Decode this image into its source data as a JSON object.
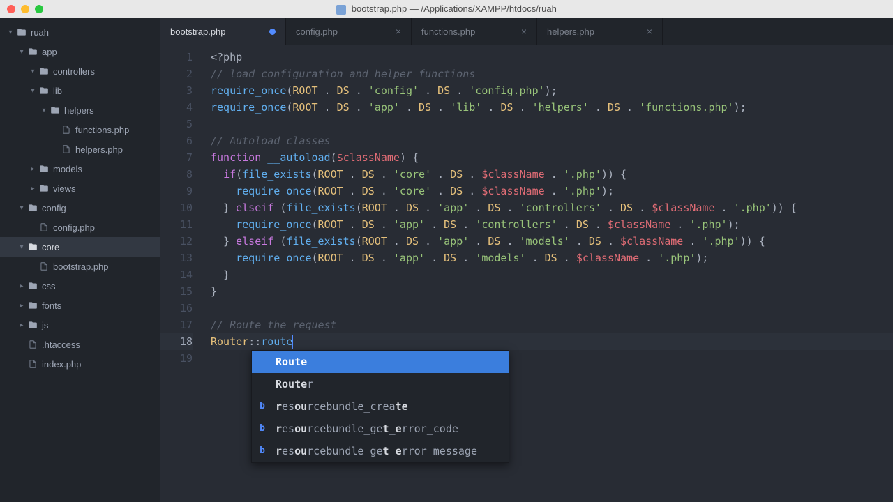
{
  "window": {
    "title": "bootstrap.php — /Applications/XAMPP/htdocs/ruah"
  },
  "sidebar": [
    {
      "depth": 0,
      "label": "ruah",
      "type": "folder",
      "open": true
    },
    {
      "depth": 1,
      "label": "app",
      "type": "folder",
      "open": true
    },
    {
      "depth": 2,
      "label": "controllers",
      "type": "folder",
      "open": true
    },
    {
      "depth": 2,
      "label": "lib",
      "type": "folder",
      "open": true
    },
    {
      "depth": 3,
      "label": "helpers",
      "type": "folder",
      "open": true
    },
    {
      "depth": 4,
      "label": "functions.php",
      "type": "file"
    },
    {
      "depth": 4,
      "label": "helpers.php",
      "type": "file"
    },
    {
      "depth": 2,
      "label": "models",
      "type": "folder",
      "open": false
    },
    {
      "depth": 2,
      "label": "views",
      "type": "folder",
      "open": false
    },
    {
      "depth": 1,
      "label": "config",
      "type": "folder",
      "open": true
    },
    {
      "depth": 2,
      "label": "config.php",
      "type": "file"
    },
    {
      "depth": 1,
      "label": "core",
      "type": "folder",
      "open": true,
      "selected": true
    },
    {
      "depth": 2,
      "label": "bootstrap.php",
      "type": "file"
    },
    {
      "depth": 1,
      "label": "css",
      "type": "folder",
      "open": false
    },
    {
      "depth": 1,
      "label": "fonts",
      "type": "folder",
      "open": false
    },
    {
      "depth": 1,
      "label": "js",
      "type": "folder",
      "open": false
    },
    {
      "depth": 1,
      "label": ".htaccess",
      "type": "file"
    },
    {
      "depth": 1,
      "label": "index.php",
      "type": "file"
    }
  ],
  "tabs": [
    {
      "label": "bootstrap.php",
      "active": true,
      "dirty": true
    },
    {
      "label": "config.php",
      "active": false,
      "dirty": false
    },
    {
      "label": "functions.php",
      "active": false,
      "dirty": false
    },
    {
      "label": "helpers.php",
      "active": false,
      "dirty": false
    }
  ],
  "code": {
    "active_line": 18,
    "lines": [
      [
        {
          "t": "delim",
          "v": "<?php"
        }
      ],
      [
        {
          "t": "cmt",
          "v": "// load configuration and helper functions"
        }
      ],
      [
        {
          "t": "fn",
          "v": "require_once"
        },
        {
          "t": "delim",
          "v": "("
        },
        {
          "t": "const",
          "v": "ROOT"
        },
        {
          "t": "delim",
          "v": " . "
        },
        {
          "t": "const",
          "v": "DS"
        },
        {
          "t": "delim",
          "v": " . "
        },
        {
          "t": "str",
          "v": "'config'"
        },
        {
          "t": "delim",
          "v": " . "
        },
        {
          "t": "const",
          "v": "DS"
        },
        {
          "t": "delim",
          "v": " . "
        },
        {
          "t": "str",
          "v": "'config.php'"
        },
        {
          "t": "delim",
          "v": ");"
        }
      ],
      [
        {
          "t": "fn",
          "v": "require_once"
        },
        {
          "t": "delim",
          "v": "("
        },
        {
          "t": "const",
          "v": "ROOT"
        },
        {
          "t": "delim",
          "v": " . "
        },
        {
          "t": "const",
          "v": "DS"
        },
        {
          "t": "delim",
          "v": " . "
        },
        {
          "t": "str",
          "v": "'app'"
        },
        {
          "t": "delim",
          "v": " . "
        },
        {
          "t": "const",
          "v": "DS"
        },
        {
          "t": "delim",
          "v": " . "
        },
        {
          "t": "str",
          "v": "'lib'"
        },
        {
          "t": "delim",
          "v": " . "
        },
        {
          "t": "const",
          "v": "DS"
        },
        {
          "t": "delim",
          "v": " . "
        },
        {
          "t": "str",
          "v": "'helpers'"
        },
        {
          "t": "delim",
          "v": " . "
        },
        {
          "t": "const",
          "v": "DS"
        },
        {
          "t": "delim",
          "v": " . "
        },
        {
          "t": "str",
          "v": "'functions.php'"
        },
        {
          "t": "delim",
          "v": ");"
        }
      ],
      [],
      [
        {
          "t": "cmt",
          "v": "// Autoload classes"
        }
      ],
      [
        {
          "t": "kw",
          "v": "function"
        },
        {
          "t": "delim",
          "v": " "
        },
        {
          "t": "fn",
          "v": "__autoload"
        },
        {
          "t": "delim",
          "v": "("
        },
        {
          "t": "var",
          "v": "$className"
        },
        {
          "t": "delim",
          "v": ") {"
        }
      ],
      [
        {
          "t": "delim",
          "v": "  "
        },
        {
          "t": "kw",
          "v": "if"
        },
        {
          "t": "delim",
          "v": "("
        },
        {
          "t": "fn",
          "v": "file_exists"
        },
        {
          "t": "delim",
          "v": "("
        },
        {
          "t": "const",
          "v": "ROOT"
        },
        {
          "t": "delim",
          "v": " . "
        },
        {
          "t": "const",
          "v": "DS"
        },
        {
          "t": "delim",
          "v": " . "
        },
        {
          "t": "str",
          "v": "'core'"
        },
        {
          "t": "delim",
          "v": " . "
        },
        {
          "t": "const",
          "v": "DS"
        },
        {
          "t": "delim",
          "v": " . "
        },
        {
          "t": "var",
          "v": "$className"
        },
        {
          "t": "delim",
          "v": " . "
        },
        {
          "t": "str",
          "v": "'.php'"
        },
        {
          "t": "delim",
          "v": ")) {"
        }
      ],
      [
        {
          "t": "delim",
          "v": "    "
        },
        {
          "t": "fn",
          "v": "require_once"
        },
        {
          "t": "delim",
          "v": "("
        },
        {
          "t": "const",
          "v": "ROOT"
        },
        {
          "t": "delim",
          "v": " . "
        },
        {
          "t": "const",
          "v": "DS"
        },
        {
          "t": "delim",
          "v": " . "
        },
        {
          "t": "str",
          "v": "'core'"
        },
        {
          "t": "delim",
          "v": " . "
        },
        {
          "t": "const",
          "v": "DS"
        },
        {
          "t": "delim",
          "v": " . "
        },
        {
          "t": "var",
          "v": "$className"
        },
        {
          "t": "delim",
          "v": " . "
        },
        {
          "t": "str",
          "v": "'.php'"
        },
        {
          "t": "delim",
          "v": ");"
        }
      ],
      [
        {
          "t": "delim",
          "v": "  } "
        },
        {
          "t": "kw",
          "v": "elseif"
        },
        {
          "t": "delim",
          "v": " ("
        },
        {
          "t": "fn",
          "v": "file_exists"
        },
        {
          "t": "delim",
          "v": "("
        },
        {
          "t": "const",
          "v": "ROOT"
        },
        {
          "t": "delim",
          "v": " . "
        },
        {
          "t": "const",
          "v": "DS"
        },
        {
          "t": "delim",
          "v": " . "
        },
        {
          "t": "str",
          "v": "'app'"
        },
        {
          "t": "delim",
          "v": " . "
        },
        {
          "t": "const",
          "v": "DS"
        },
        {
          "t": "delim",
          "v": " . "
        },
        {
          "t": "str",
          "v": "'controllers'"
        },
        {
          "t": "delim",
          "v": " . "
        },
        {
          "t": "const",
          "v": "DS"
        },
        {
          "t": "delim",
          "v": " . "
        },
        {
          "t": "var",
          "v": "$className"
        },
        {
          "t": "delim",
          "v": " . "
        },
        {
          "t": "str",
          "v": "'.php'"
        },
        {
          "t": "delim",
          "v": ")) {"
        }
      ],
      [
        {
          "t": "delim",
          "v": "    "
        },
        {
          "t": "fn",
          "v": "require_once"
        },
        {
          "t": "delim",
          "v": "("
        },
        {
          "t": "const",
          "v": "ROOT"
        },
        {
          "t": "delim",
          "v": " . "
        },
        {
          "t": "const",
          "v": "DS"
        },
        {
          "t": "delim",
          "v": " . "
        },
        {
          "t": "str",
          "v": "'app'"
        },
        {
          "t": "delim",
          "v": " . "
        },
        {
          "t": "const",
          "v": "DS"
        },
        {
          "t": "delim",
          "v": " . "
        },
        {
          "t": "str",
          "v": "'controllers'"
        },
        {
          "t": "delim",
          "v": " . "
        },
        {
          "t": "const",
          "v": "DS"
        },
        {
          "t": "delim",
          "v": " . "
        },
        {
          "t": "var",
          "v": "$className"
        },
        {
          "t": "delim",
          "v": " . "
        },
        {
          "t": "str",
          "v": "'.php'"
        },
        {
          "t": "delim",
          "v": ");"
        }
      ],
      [
        {
          "t": "delim",
          "v": "  } "
        },
        {
          "t": "kw",
          "v": "elseif"
        },
        {
          "t": "delim",
          "v": " ("
        },
        {
          "t": "fn",
          "v": "file_exists"
        },
        {
          "t": "delim",
          "v": "("
        },
        {
          "t": "const",
          "v": "ROOT"
        },
        {
          "t": "delim",
          "v": " . "
        },
        {
          "t": "const",
          "v": "DS"
        },
        {
          "t": "delim",
          "v": " . "
        },
        {
          "t": "str",
          "v": "'app'"
        },
        {
          "t": "delim",
          "v": " . "
        },
        {
          "t": "const",
          "v": "DS"
        },
        {
          "t": "delim",
          "v": " . "
        },
        {
          "t": "str",
          "v": "'models'"
        },
        {
          "t": "delim",
          "v": " . "
        },
        {
          "t": "const",
          "v": "DS"
        },
        {
          "t": "delim",
          "v": " . "
        },
        {
          "t": "var",
          "v": "$className"
        },
        {
          "t": "delim",
          "v": " . "
        },
        {
          "t": "str",
          "v": "'.php'"
        },
        {
          "t": "delim",
          "v": ")) {"
        }
      ],
      [
        {
          "t": "delim",
          "v": "    "
        },
        {
          "t": "fn",
          "v": "require_once"
        },
        {
          "t": "delim",
          "v": "("
        },
        {
          "t": "const",
          "v": "ROOT"
        },
        {
          "t": "delim",
          "v": " . "
        },
        {
          "t": "const",
          "v": "DS"
        },
        {
          "t": "delim",
          "v": " . "
        },
        {
          "t": "str",
          "v": "'app'"
        },
        {
          "t": "delim",
          "v": " . "
        },
        {
          "t": "const",
          "v": "DS"
        },
        {
          "t": "delim",
          "v": " . "
        },
        {
          "t": "str",
          "v": "'models'"
        },
        {
          "t": "delim",
          "v": " . "
        },
        {
          "t": "const",
          "v": "DS"
        },
        {
          "t": "delim",
          "v": " . "
        },
        {
          "t": "var",
          "v": "$className"
        },
        {
          "t": "delim",
          "v": " . "
        },
        {
          "t": "str",
          "v": "'.php'"
        },
        {
          "t": "delim",
          "v": ");"
        }
      ],
      [
        {
          "t": "delim",
          "v": "  }"
        }
      ],
      [
        {
          "t": "delim",
          "v": "}"
        }
      ],
      [],
      [
        {
          "t": "cmt",
          "v": "// Route the request"
        }
      ],
      [
        {
          "t": "class",
          "v": "Router"
        },
        {
          "t": "delim",
          "v": "::"
        },
        {
          "t": "fn",
          "v": "route"
        },
        {
          "t": "cursor",
          "v": ""
        }
      ],
      []
    ]
  },
  "autocomplete": {
    "items": [
      {
        "icon": "",
        "parts": [
          {
            "hl": true,
            "v": "Route"
          }
        ],
        "selected": true
      },
      {
        "icon": "",
        "parts": [
          {
            "hl": true,
            "v": "Route"
          },
          {
            "hl": false,
            "v": "r"
          }
        ]
      },
      {
        "icon": "b",
        "parts": [
          {
            "hl": true,
            "v": "r"
          },
          {
            "hl": false,
            "v": "es"
          },
          {
            "hl": true,
            "v": "ou"
          },
          {
            "hl": false,
            "v": "rcebundle_crea"
          },
          {
            "hl": true,
            "v": "te"
          }
        ]
      },
      {
        "icon": "b",
        "parts": [
          {
            "hl": true,
            "v": "r"
          },
          {
            "hl": false,
            "v": "es"
          },
          {
            "hl": true,
            "v": "ou"
          },
          {
            "hl": false,
            "v": "rcebundle_ge"
          },
          {
            "hl": true,
            "v": "t"
          },
          {
            "hl": false,
            "v": "_"
          },
          {
            "hl": true,
            "v": "e"
          },
          {
            "hl": false,
            "v": "rror_code"
          }
        ]
      },
      {
        "icon": "b",
        "parts": [
          {
            "hl": true,
            "v": "r"
          },
          {
            "hl": false,
            "v": "es"
          },
          {
            "hl": true,
            "v": "ou"
          },
          {
            "hl": false,
            "v": "rcebundle_ge"
          },
          {
            "hl": true,
            "v": "t"
          },
          {
            "hl": false,
            "v": "_"
          },
          {
            "hl": true,
            "v": "e"
          },
          {
            "hl": false,
            "v": "rror_message"
          }
        ]
      }
    ]
  }
}
